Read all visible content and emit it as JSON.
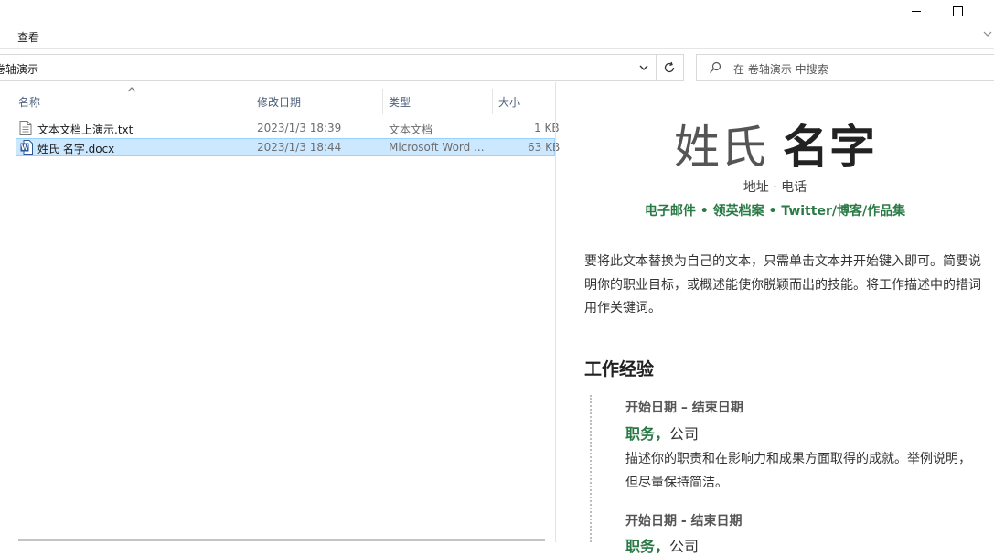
{
  "ribbon": {
    "view_tab": "查看"
  },
  "address_bar": {
    "path": "卷轴演示"
  },
  "search": {
    "placeholder": "在 卷轴演示 中搜索"
  },
  "columns": {
    "name": "名称",
    "modified": "修改日期",
    "type": "类型",
    "size": "大小"
  },
  "files": [
    {
      "name": "文本文档上演示.txt",
      "modified": "2023/1/3 18:39",
      "type": "文本文档",
      "size": "1 KB",
      "icon": "text-file-icon",
      "selected": false
    },
    {
      "name": "姓氏 名字.docx",
      "modified": "2023/1/3 18:44",
      "type": "Microsoft Word ...",
      "size": "63 KB",
      "icon": "word-document-icon",
      "selected": true
    }
  ],
  "preview": {
    "surname": "姓氏",
    "given_name": "名字",
    "address_line": "地址 · 电话",
    "links_line": "电子邮件 • 领英档案 • Twitter/博客/作品集",
    "objective": "要将此文本替换为自己的文本，只需单击文本并开始键入即可。简要说明你的职业目标，或概述能使你脱颖而出的技能。将工作描述中的措词用作关键词。",
    "section_title": "工作经验",
    "jobs": [
      {
        "dates": "开始日期 – 结束日期",
        "title": "职务，",
        "company": "公司",
        "description": "描述你的职责和在影响力和成果方面取得的成就。举例说明，但尽量保持简洁。"
      },
      {
        "dates": "开始日期 - 结束日期",
        "title": "职务，",
        "company": "公司"
      }
    ]
  },
  "colors": {
    "selection": "#cce8ff",
    "accent_green": "#2a7a45"
  }
}
